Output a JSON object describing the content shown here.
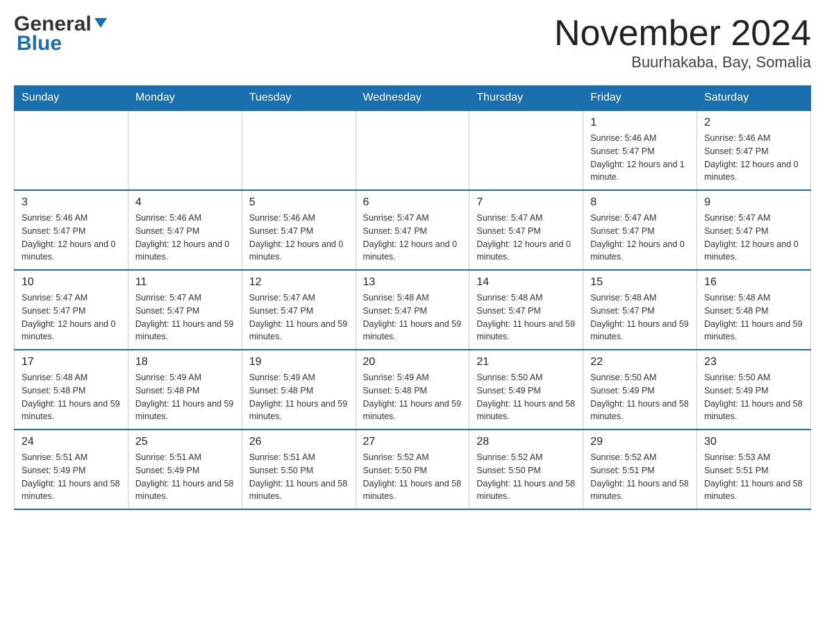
{
  "header": {
    "logo_general": "General",
    "logo_blue": "Blue",
    "title": "November 2024",
    "subtitle": "Buurhakaba, Bay, Somalia"
  },
  "days_of_week": [
    "Sunday",
    "Monday",
    "Tuesday",
    "Wednesday",
    "Thursday",
    "Friday",
    "Saturday"
  ],
  "weeks": [
    [
      {
        "day": "",
        "info": ""
      },
      {
        "day": "",
        "info": ""
      },
      {
        "day": "",
        "info": ""
      },
      {
        "day": "",
        "info": ""
      },
      {
        "day": "",
        "info": ""
      },
      {
        "day": "1",
        "info": "Sunrise: 5:46 AM\nSunset: 5:47 PM\nDaylight: 12 hours and 1 minute."
      },
      {
        "day": "2",
        "info": "Sunrise: 5:46 AM\nSunset: 5:47 PM\nDaylight: 12 hours and 0 minutes."
      }
    ],
    [
      {
        "day": "3",
        "info": "Sunrise: 5:46 AM\nSunset: 5:47 PM\nDaylight: 12 hours and 0 minutes."
      },
      {
        "day": "4",
        "info": "Sunrise: 5:46 AM\nSunset: 5:47 PM\nDaylight: 12 hours and 0 minutes."
      },
      {
        "day": "5",
        "info": "Sunrise: 5:46 AM\nSunset: 5:47 PM\nDaylight: 12 hours and 0 minutes."
      },
      {
        "day": "6",
        "info": "Sunrise: 5:47 AM\nSunset: 5:47 PM\nDaylight: 12 hours and 0 minutes."
      },
      {
        "day": "7",
        "info": "Sunrise: 5:47 AM\nSunset: 5:47 PM\nDaylight: 12 hours and 0 minutes."
      },
      {
        "day": "8",
        "info": "Sunrise: 5:47 AM\nSunset: 5:47 PM\nDaylight: 12 hours and 0 minutes."
      },
      {
        "day": "9",
        "info": "Sunrise: 5:47 AM\nSunset: 5:47 PM\nDaylight: 12 hours and 0 minutes."
      }
    ],
    [
      {
        "day": "10",
        "info": "Sunrise: 5:47 AM\nSunset: 5:47 PM\nDaylight: 12 hours and 0 minutes."
      },
      {
        "day": "11",
        "info": "Sunrise: 5:47 AM\nSunset: 5:47 PM\nDaylight: 11 hours and 59 minutes."
      },
      {
        "day": "12",
        "info": "Sunrise: 5:47 AM\nSunset: 5:47 PM\nDaylight: 11 hours and 59 minutes."
      },
      {
        "day": "13",
        "info": "Sunrise: 5:48 AM\nSunset: 5:47 PM\nDaylight: 11 hours and 59 minutes."
      },
      {
        "day": "14",
        "info": "Sunrise: 5:48 AM\nSunset: 5:47 PM\nDaylight: 11 hours and 59 minutes."
      },
      {
        "day": "15",
        "info": "Sunrise: 5:48 AM\nSunset: 5:47 PM\nDaylight: 11 hours and 59 minutes."
      },
      {
        "day": "16",
        "info": "Sunrise: 5:48 AM\nSunset: 5:48 PM\nDaylight: 11 hours and 59 minutes."
      }
    ],
    [
      {
        "day": "17",
        "info": "Sunrise: 5:48 AM\nSunset: 5:48 PM\nDaylight: 11 hours and 59 minutes."
      },
      {
        "day": "18",
        "info": "Sunrise: 5:49 AM\nSunset: 5:48 PM\nDaylight: 11 hours and 59 minutes."
      },
      {
        "day": "19",
        "info": "Sunrise: 5:49 AM\nSunset: 5:48 PM\nDaylight: 11 hours and 59 minutes."
      },
      {
        "day": "20",
        "info": "Sunrise: 5:49 AM\nSunset: 5:48 PM\nDaylight: 11 hours and 59 minutes."
      },
      {
        "day": "21",
        "info": "Sunrise: 5:50 AM\nSunset: 5:49 PM\nDaylight: 11 hours and 58 minutes."
      },
      {
        "day": "22",
        "info": "Sunrise: 5:50 AM\nSunset: 5:49 PM\nDaylight: 11 hours and 58 minutes."
      },
      {
        "day": "23",
        "info": "Sunrise: 5:50 AM\nSunset: 5:49 PM\nDaylight: 11 hours and 58 minutes."
      }
    ],
    [
      {
        "day": "24",
        "info": "Sunrise: 5:51 AM\nSunset: 5:49 PM\nDaylight: 11 hours and 58 minutes."
      },
      {
        "day": "25",
        "info": "Sunrise: 5:51 AM\nSunset: 5:49 PM\nDaylight: 11 hours and 58 minutes."
      },
      {
        "day": "26",
        "info": "Sunrise: 5:51 AM\nSunset: 5:50 PM\nDaylight: 11 hours and 58 minutes."
      },
      {
        "day": "27",
        "info": "Sunrise: 5:52 AM\nSunset: 5:50 PM\nDaylight: 11 hours and 58 minutes."
      },
      {
        "day": "28",
        "info": "Sunrise: 5:52 AM\nSunset: 5:50 PM\nDaylight: 11 hours and 58 minutes."
      },
      {
        "day": "29",
        "info": "Sunrise: 5:52 AM\nSunset: 5:51 PM\nDaylight: 11 hours and 58 minutes."
      },
      {
        "day": "30",
        "info": "Sunrise: 5:53 AM\nSunset: 5:51 PM\nDaylight: 11 hours and 58 minutes."
      }
    ]
  ]
}
